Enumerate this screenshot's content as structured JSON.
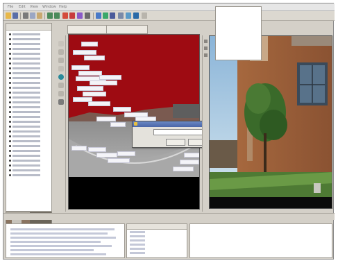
{
  "window": {
    "title": ""
  },
  "menu": [
    "File",
    "Edit",
    "View",
    "Window",
    "Help"
  ],
  "toolbar": {
    "icons": [
      "folder-open-icon",
      "save-icon",
      "cut-icon",
      "copy-icon",
      "paste-icon",
      "undo-icon",
      "redo-icon",
      "zoom-icon",
      "select-icon",
      "brush-icon",
      "tag-icon",
      "grid-icon",
      "color-icon",
      "eye-icon",
      "link-icon",
      "settings-icon",
      "help-icon"
    ]
  },
  "sidebar": {
    "items": [
      "",
      "",
      "",
      "",
      "",
      "",
      "",
      "",
      "",
      "",
      "",
      "",
      "",
      "",
      "",
      "",
      "",
      "",
      "",
      "",
      "",
      "",
      "",
      "",
      "",
      "",
      "",
      "",
      "",
      ""
    ]
  },
  "editor": {
    "tabs": [
      "",
      ""
    ]
  },
  "dialog": {
    "title": "",
    "field_label": "",
    "field_value": "",
    "option_label": "",
    "ok_label": "",
    "cancel_label": ""
  },
  "table": {
    "headers": [
      "",
      "",
      ""
    ],
    "rows": [
      "",
      "",
      "",
      "",
      "",
      "",
      ""
    ]
  },
  "colors": {
    "app_bg": "#d4d0c8",
    "mask_red": "#9e0b12",
    "dialog_title": "#4a66a8"
  }
}
